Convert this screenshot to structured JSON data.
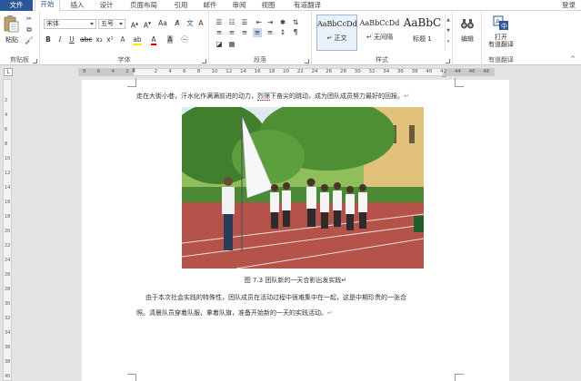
{
  "tabs": {
    "file": "文件",
    "items": [
      "开始",
      "插入",
      "设计",
      "页面布局",
      "引用",
      "邮件",
      "审阅",
      "视图",
      "有道翻译"
    ],
    "active_index": 0,
    "login": "登录"
  },
  "ribbon": {
    "clipboard": {
      "paste": "粘贴",
      "label": "剪贴板"
    },
    "font": {
      "name": "宋体",
      "size": "五号",
      "label": "字体"
    },
    "paragraph": {
      "label": "段落"
    },
    "styles": {
      "label": "样式",
      "items": [
        {
          "sample": "AaBbCcDd",
          "name": "↵ 正文"
        },
        {
          "sample": "AaBbCcDd",
          "name": "↵ 无间隔"
        },
        {
          "sample": "AaBbC",
          "name": "标题 1"
        }
      ]
    },
    "editing": {
      "label": "编辑"
    },
    "youdao": {
      "button": "打开\n有道翻译",
      "label": "有道翻译"
    }
  },
  "ruler": {
    "tab_selector": "L",
    "numbers": [
      "8",
      "6",
      "4",
      "2",
      "",
      "2",
      "4",
      "6",
      "8",
      "10",
      "12",
      "14",
      "16",
      "18",
      "20",
      "22",
      "24",
      "26",
      "28",
      "30",
      "32",
      "34",
      "36",
      "38",
      "40",
      "42",
      "44",
      "46",
      "48"
    ]
  },
  "vruler": {
    "numbers": [
      "2",
      "4",
      "6",
      "8",
      "10",
      "12",
      "14",
      "16",
      "18",
      "20",
      "22",
      "24",
      "26",
      "28",
      "30",
      "32",
      "34",
      "36",
      "38",
      "40"
    ]
  },
  "document": {
    "para1_before": "走在大街小巷，汗水化作满满前进的动力，",
    "para1_underlined": "烈筛",
    "para1_after": "下奋尖的跳动，成为团队成员努力最好的回报。",
    "caption": "图 7.3 团队新的一天合影出发实践",
    "para2_line1": "由于本次社会实践的特殊性，团队成员在活动过程中很难集中在一起，这是中期珍贵的一张合",
    "para2_line2": "照。清晨队员穿着队服，拿着队旗，准备开始新的一天的实践活动。",
    "mark": "↵"
  }
}
